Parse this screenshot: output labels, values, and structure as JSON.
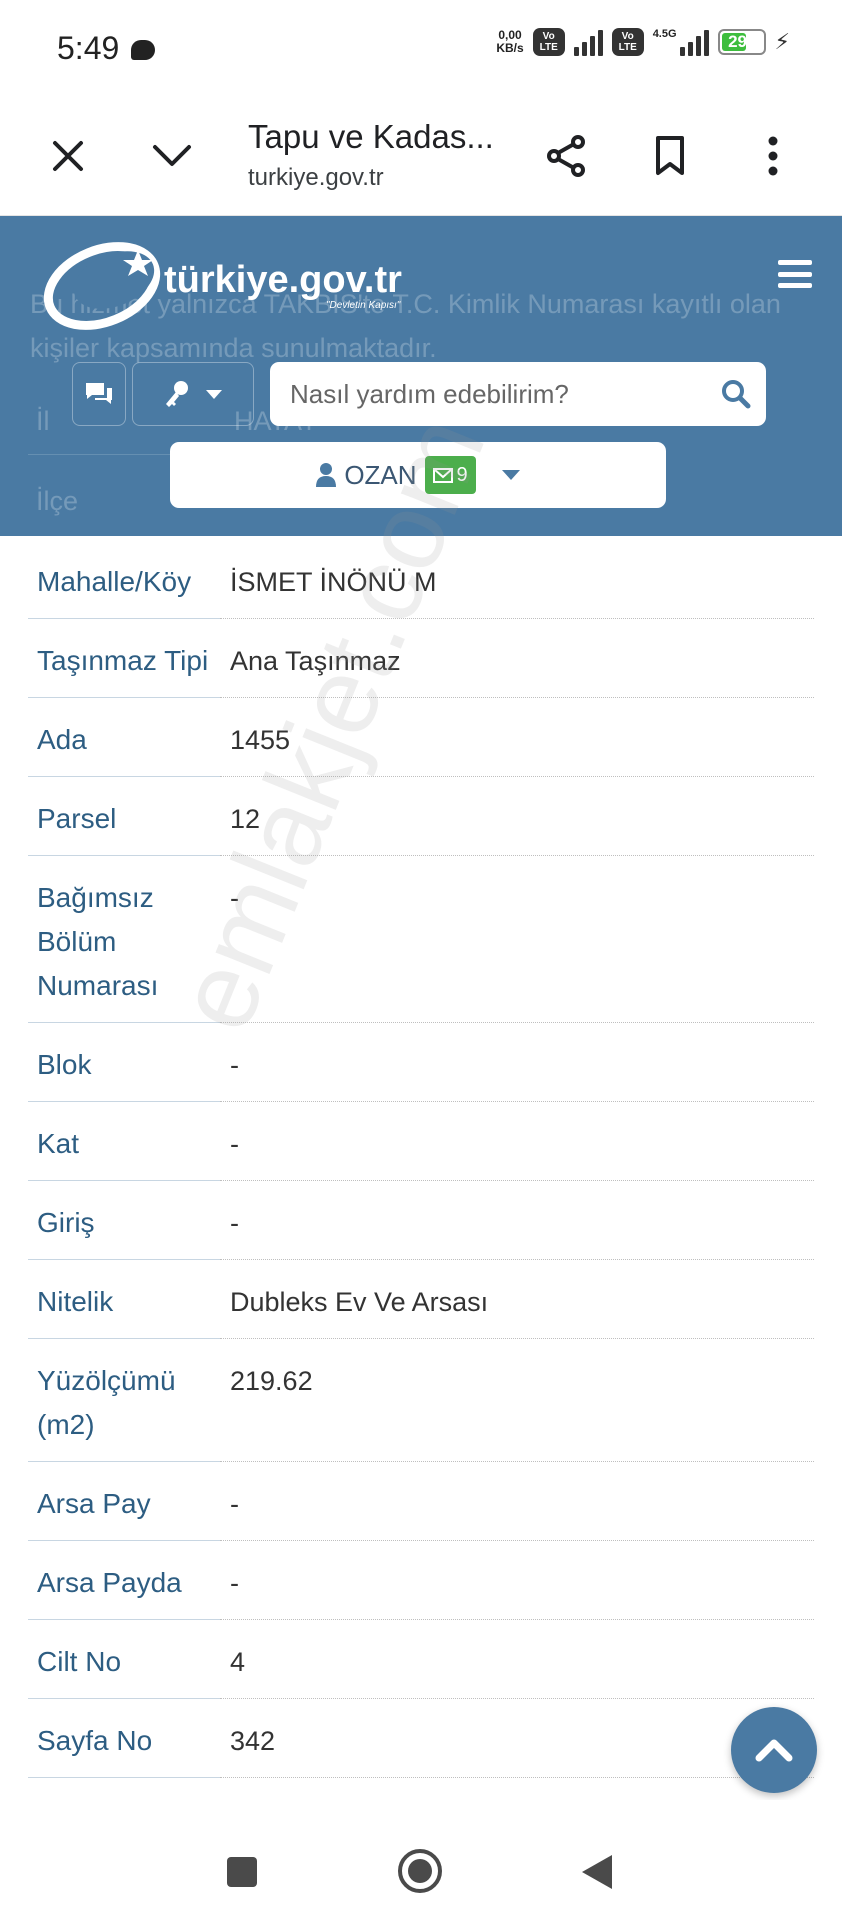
{
  "status_bar": {
    "time": "5:49",
    "data_speed": "0,00",
    "data_unit": "KB/s",
    "volte_1": "Vo LTE",
    "volte_2": "Vo LTE",
    "network": "4.5G",
    "battery": "29",
    "battery_color": "#3dbd3d"
  },
  "browser": {
    "title": "Tapu ve Kadas...",
    "url": "turkiye.gov.tr"
  },
  "header": {
    "brand_color": "#4a7aa3",
    "logo_text": "türkiye.gov.tr",
    "logo_tagline": "\"Devletin Kapısı\"",
    "info_text": "Bu hizmet yalnızca TAKBİS'te T.C. Kimlik Numarası kayıtlı olan kişiler kapsamında sunulmaktadır.",
    "hidden_rows": [
      {
        "label": "İl",
        "value": "HATAY"
      },
      {
        "label": "İlçe",
        "value": ""
      }
    ],
    "search_placeholder": "Nasıl yardım edebilirim?",
    "user_name": "OZAN",
    "message_count": "9"
  },
  "table": {
    "rows": [
      {
        "label": "Mahalle/Köy",
        "value": "İSMET İNÖNÜ M"
      },
      {
        "label": "Taşınmaz Tipi",
        "value": "Ana Taşınmaz"
      },
      {
        "label": "Ada",
        "value": "1455"
      },
      {
        "label": "Parsel",
        "value": "12"
      },
      {
        "label": "Bağımsız Bölüm Numarası",
        "value": "-"
      },
      {
        "label": "Blok",
        "value": "-"
      },
      {
        "label": "Kat",
        "value": "-"
      },
      {
        "label": "Giriş",
        "value": "-"
      },
      {
        "label": "Nitelik",
        "value": "Dubleks Ev Ve Arsası"
      },
      {
        "label": "Yüzölçümü (m2)",
        "value": "219.62"
      },
      {
        "label": "Arsa Pay",
        "value": "-"
      },
      {
        "label": "Arsa Payda",
        "value": "-"
      },
      {
        "label": "Cilt No",
        "value": "4"
      },
      {
        "label": "Sayfa No",
        "value": "342"
      }
    ]
  },
  "watermark": "emlakjet.com"
}
